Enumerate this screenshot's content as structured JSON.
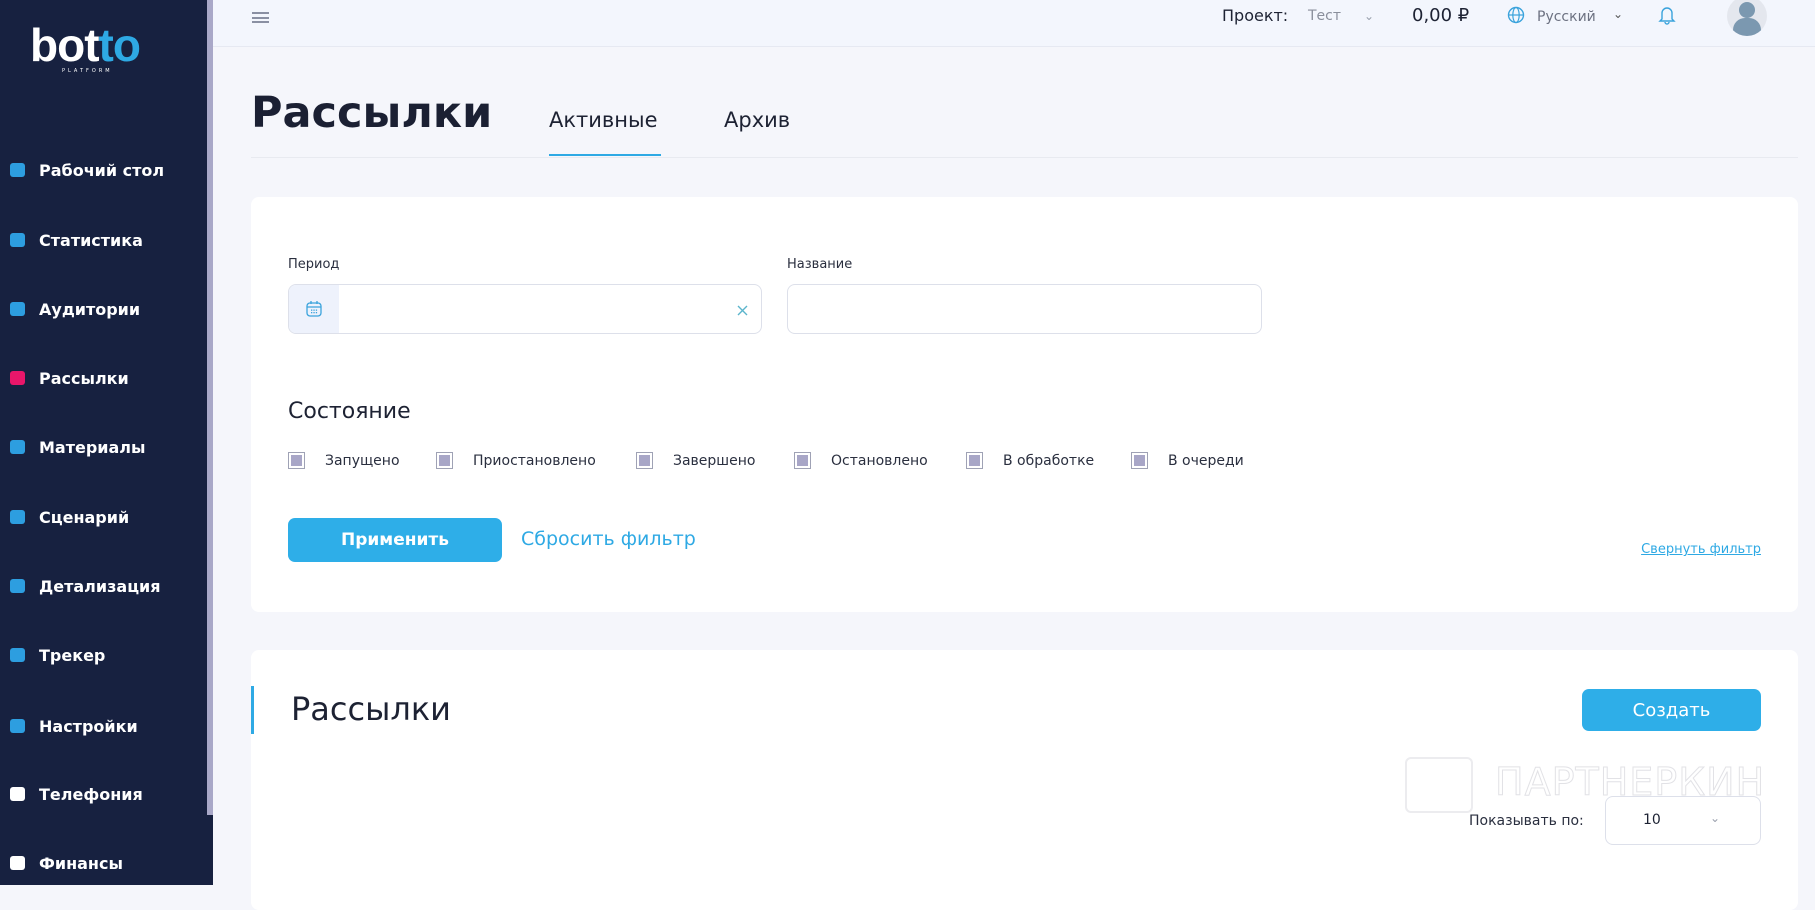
{
  "logo": {
    "name": "botto",
    "sub": "PLATFORM"
  },
  "sidebar": {
    "items": [
      {
        "label": "Рабочий стол",
        "icon": "dashboard-icon",
        "color": "#2d9ee0"
      },
      {
        "label": "Статистика",
        "icon": "chart-icon",
        "color": "#2d9ee0"
      },
      {
        "label": "Аудитории",
        "icon": "users-icon",
        "color": "#2d9ee0"
      },
      {
        "label": "Рассылки",
        "icon": "mailing-icon",
        "color": "#e9166a"
      },
      {
        "label": "Материалы",
        "icon": "materials-icon",
        "color": "#2d9ee0"
      },
      {
        "label": "Сценарий",
        "icon": "scenario-icon",
        "color": "#2d9ee0"
      },
      {
        "label": "Детализация",
        "icon": "details-icon",
        "color": "#2d9ee0"
      },
      {
        "label": "Трекер",
        "icon": "tracker-icon",
        "color": "#2d9ee0"
      },
      {
        "label": "Настройки",
        "icon": "gear-icon",
        "color": "#2d9ee0"
      },
      {
        "label": "Телефония",
        "icon": "phone-icon",
        "color": "#ffffff"
      },
      {
        "label": "Финансы",
        "icon": "wallet-icon",
        "color": "#ffffff"
      }
    ]
  },
  "header": {
    "project_label": "Проект:",
    "project_value": "Тест",
    "balance": "0,00 ₽",
    "language": "Русский"
  },
  "page": {
    "title": "Рассылки",
    "tabs": [
      {
        "label": "Активные",
        "active": true
      },
      {
        "label": "Архив",
        "active": false
      }
    ]
  },
  "filter": {
    "period_label": "Период",
    "period_value": "",
    "name_label": "Название",
    "name_value": "",
    "state_title": "Состояние",
    "states": [
      "Запущено",
      "Приостановлено",
      "Завершено",
      "Остановлено",
      "В обработке",
      "В очереди"
    ],
    "apply": "Применить",
    "reset": "Сбросить фильтр",
    "collapse": "Свернуть фильтр"
  },
  "list": {
    "title": "Рассылки",
    "create": "Создать",
    "per_page_label": "Показывать по:",
    "per_page_value": "10"
  },
  "watermark": "ПАРТНЕРКИН"
}
